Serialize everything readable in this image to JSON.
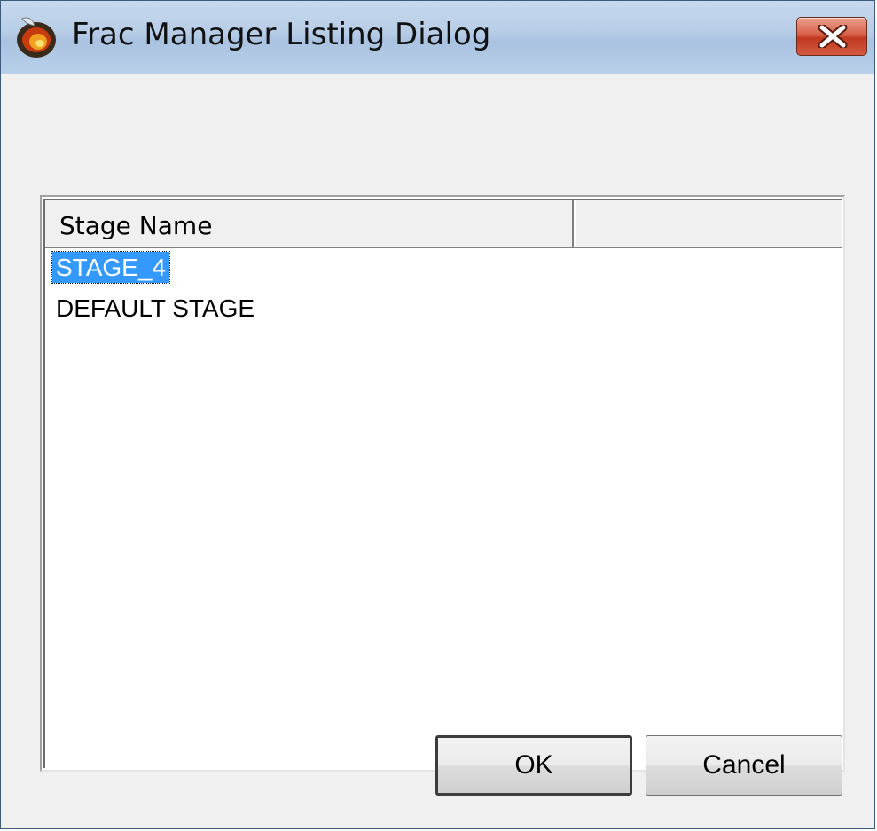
{
  "window": {
    "title": "Frac Manager Listing Dialog",
    "icon": "app-flame-icon",
    "close_icon": "close-icon"
  },
  "list": {
    "columns": [
      "Stage Name",
      ""
    ],
    "rows": [
      {
        "label": "STAGE_4",
        "selected": true
      },
      {
        "label": "DEFAULT STAGE",
        "selected": false
      }
    ],
    "selection_color": "#3399ff"
  },
  "buttons": {
    "ok_label": "OK",
    "cancel_label": "Cancel"
  }
}
